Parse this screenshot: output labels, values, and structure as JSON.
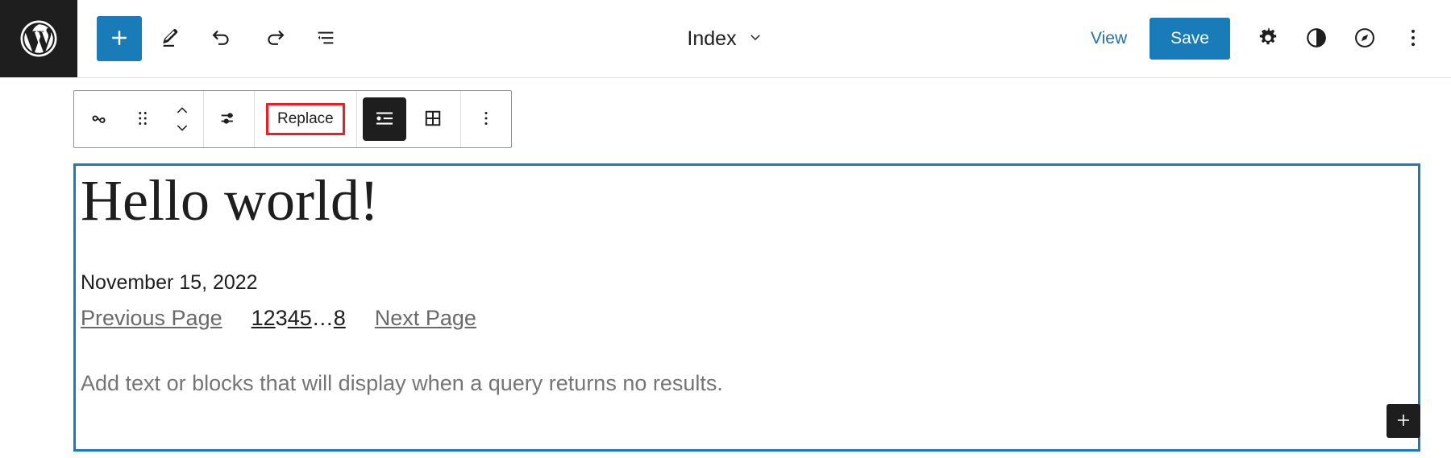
{
  "header": {
    "logo_icon": "wordpress-logo-icon",
    "tools": [
      {
        "name": "add-block-button",
        "icon": "plus-icon",
        "label": "Add block"
      },
      {
        "name": "edit-mode-button",
        "icon": "pencil-icon",
        "label": "Edit"
      },
      {
        "name": "undo-button",
        "icon": "undo-icon",
        "label": "Undo"
      },
      {
        "name": "redo-button",
        "icon": "redo-icon",
        "label": "Redo"
      },
      {
        "name": "list-view-button",
        "icon": "list-view-icon",
        "label": "List View"
      }
    ],
    "document_title": "Index",
    "document_title_chevron": "chevron-down-icon",
    "view_label": "View",
    "save_label": "Save",
    "right_icons": [
      {
        "name": "settings-button",
        "icon": "gear-icon",
        "label": "Settings"
      },
      {
        "name": "styles-button",
        "icon": "contrast-circle-icon",
        "label": "Styles"
      },
      {
        "name": "navigation-button",
        "icon": "compass-circle-icon",
        "label": "Navigation"
      },
      {
        "name": "more-options-button",
        "icon": "vertical-ellipsis-icon",
        "label": "Options"
      }
    ],
    "accent_color": "#1a7bb9",
    "link_color": "#2271b1",
    "logo_bg": "#1e1e1e"
  },
  "block_toolbar": {
    "block_type_icon": "query-loop-icon",
    "drag_handle_icon": "drag-handle-icon",
    "move_up_icon": "chevron-up-icon",
    "move_down_icon": "chevron-down-icon",
    "display_settings_icon": "settings-sliders-icon",
    "replace_label": "Replace",
    "replace_highlight_color": "#ee1c25",
    "list_view_icon": "list-layout-icon",
    "grid_view_icon": "grid-layout-icon",
    "list_view_active": true,
    "more_options_icon": "vertical-ellipsis-icon"
  },
  "content": {
    "post_title": "Hello world!",
    "post_date": "November 15, 2022",
    "pagination": {
      "previous_label": "Previous Page",
      "numbers": [
        "1",
        "2",
        "3",
        "4",
        "5"
      ],
      "current": "3",
      "ellipsis": "…",
      "last": "8",
      "next_label": "Next Page"
    },
    "no_results_placeholder": "Add text or blocks that will display when a query returns no results.",
    "appender_icon": "plus-icon",
    "selection_border_color": "#1a7bb9"
  }
}
